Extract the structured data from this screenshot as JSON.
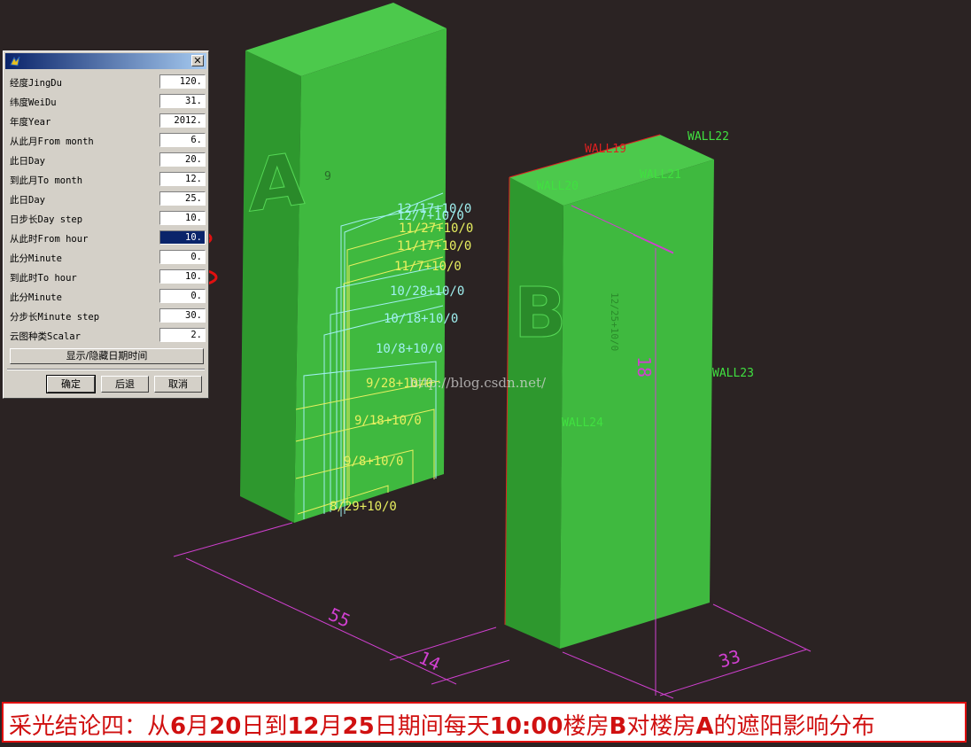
{
  "colors": {
    "background": "#2b2323",
    "building_front": "#3fb93f",
    "building_top": "#4cc94c",
    "building_side": "#2e982e",
    "dimension": "#d040d0",
    "wall_label": "#40e040",
    "wall_label_red": "#e02020",
    "curve_cyan": "#a0f0f0",
    "curve_yellow": "#e8f060",
    "caption_red": "#d01010"
  },
  "dialog": {
    "app_icon": "app-icon",
    "close_label": "✕",
    "fields": [
      {
        "label": "经度JingDu",
        "value": "120."
      },
      {
        "label": "纬度WeiDu",
        "value": "31."
      },
      {
        "label": "年度Year",
        "value": "2012."
      },
      {
        "label": "从此月From month",
        "value": "6."
      },
      {
        "label": "此日Day",
        "value": "20."
      },
      {
        "label": "到此月To month",
        "value": "12."
      },
      {
        "label": "此日Day",
        "value": "25."
      },
      {
        "label": "日步长Day step",
        "value": "10."
      },
      {
        "label": "从此时From hour",
        "value": "10.",
        "selected": true,
        "circled": true
      },
      {
        "label": "此分Minute",
        "value": "0."
      },
      {
        "label": "到此时To hour",
        "value": "10.",
        "circled": true
      },
      {
        "label": "此分Minute",
        "value": "0."
      },
      {
        "label": "分步长Minute step",
        "value": "30."
      },
      {
        "label": "云图种类Scalar",
        "value": "2."
      }
    ],
    "toggle_label": "显示/隐藏日期时间",
    "ok_label": "确定",
    "back_label": "后退",
    "cancel_label": "取消"
  },
  "scene": {
    "building_a_label": "A",
    "building_b_label": "B",
    "small_label_9": "9",
    "walls": {
      "wall19": "WALL19",
      "wall20": "WALL20",
      "wall21": "WALL21",
      "wall22": "WALL22",
      "wall23": "WALL23",
      "wall24": "WALL24"
    },
    "shadow_dates": [
      {
        "text": "12/17+10/0",
        "color": "cyan"
      },
      {
        "text": "12/7+10/0",
        "color": "cyan"
      },
      {
        "text": "11/27+10/0",
        "color": "yellow"
      },
      {
        "text": "11/17+10/0",
        "color": "yellow"
      },
      {
        "text": "11/7+10/0",
        "color": "yellow"
      },
      {
        "text": "10/28+10/0",
        "color": "cyan"
      },
      {
        "text": "10/18+10/0",
        "color": "cyan"
      },
      {
        "text": "10/8+10/0",
        "color": "cyan"
      },
      {
        "text": "9/28+10/0",
        "color": "yellow"
      },
      {
        "text": "9/18+10/0",
        "color": "yellow"
      },
      {
        "text": "9/8+10/0",
        "color": "yellow"
      },
      {
        "text": "8/29+10/0",
        "color": "yellow"
      }
    ],
    "dims": {
      "d55": "55",
      "d14": "14",
      "d33": "33",
      "d18": "18"
    },
    "watermark": "http://blog.csdn.net/"
  },
  "caption": {
    "p1": "采光结论四：从",
    "n1": "6",
    "p2": "月",
    "n2": "20",
    "p3": "日到",
    "n3": "12",
    "p4": "月",
    "n4": "25",
    "p5": "日期间每天",
    "n5": "10:00",
    "p6": "楼房",
    "n6": "B",
    "p7": "对楼房",
    "n7": "A",
    "p8": "的遮阳影响分布"
  }
}
